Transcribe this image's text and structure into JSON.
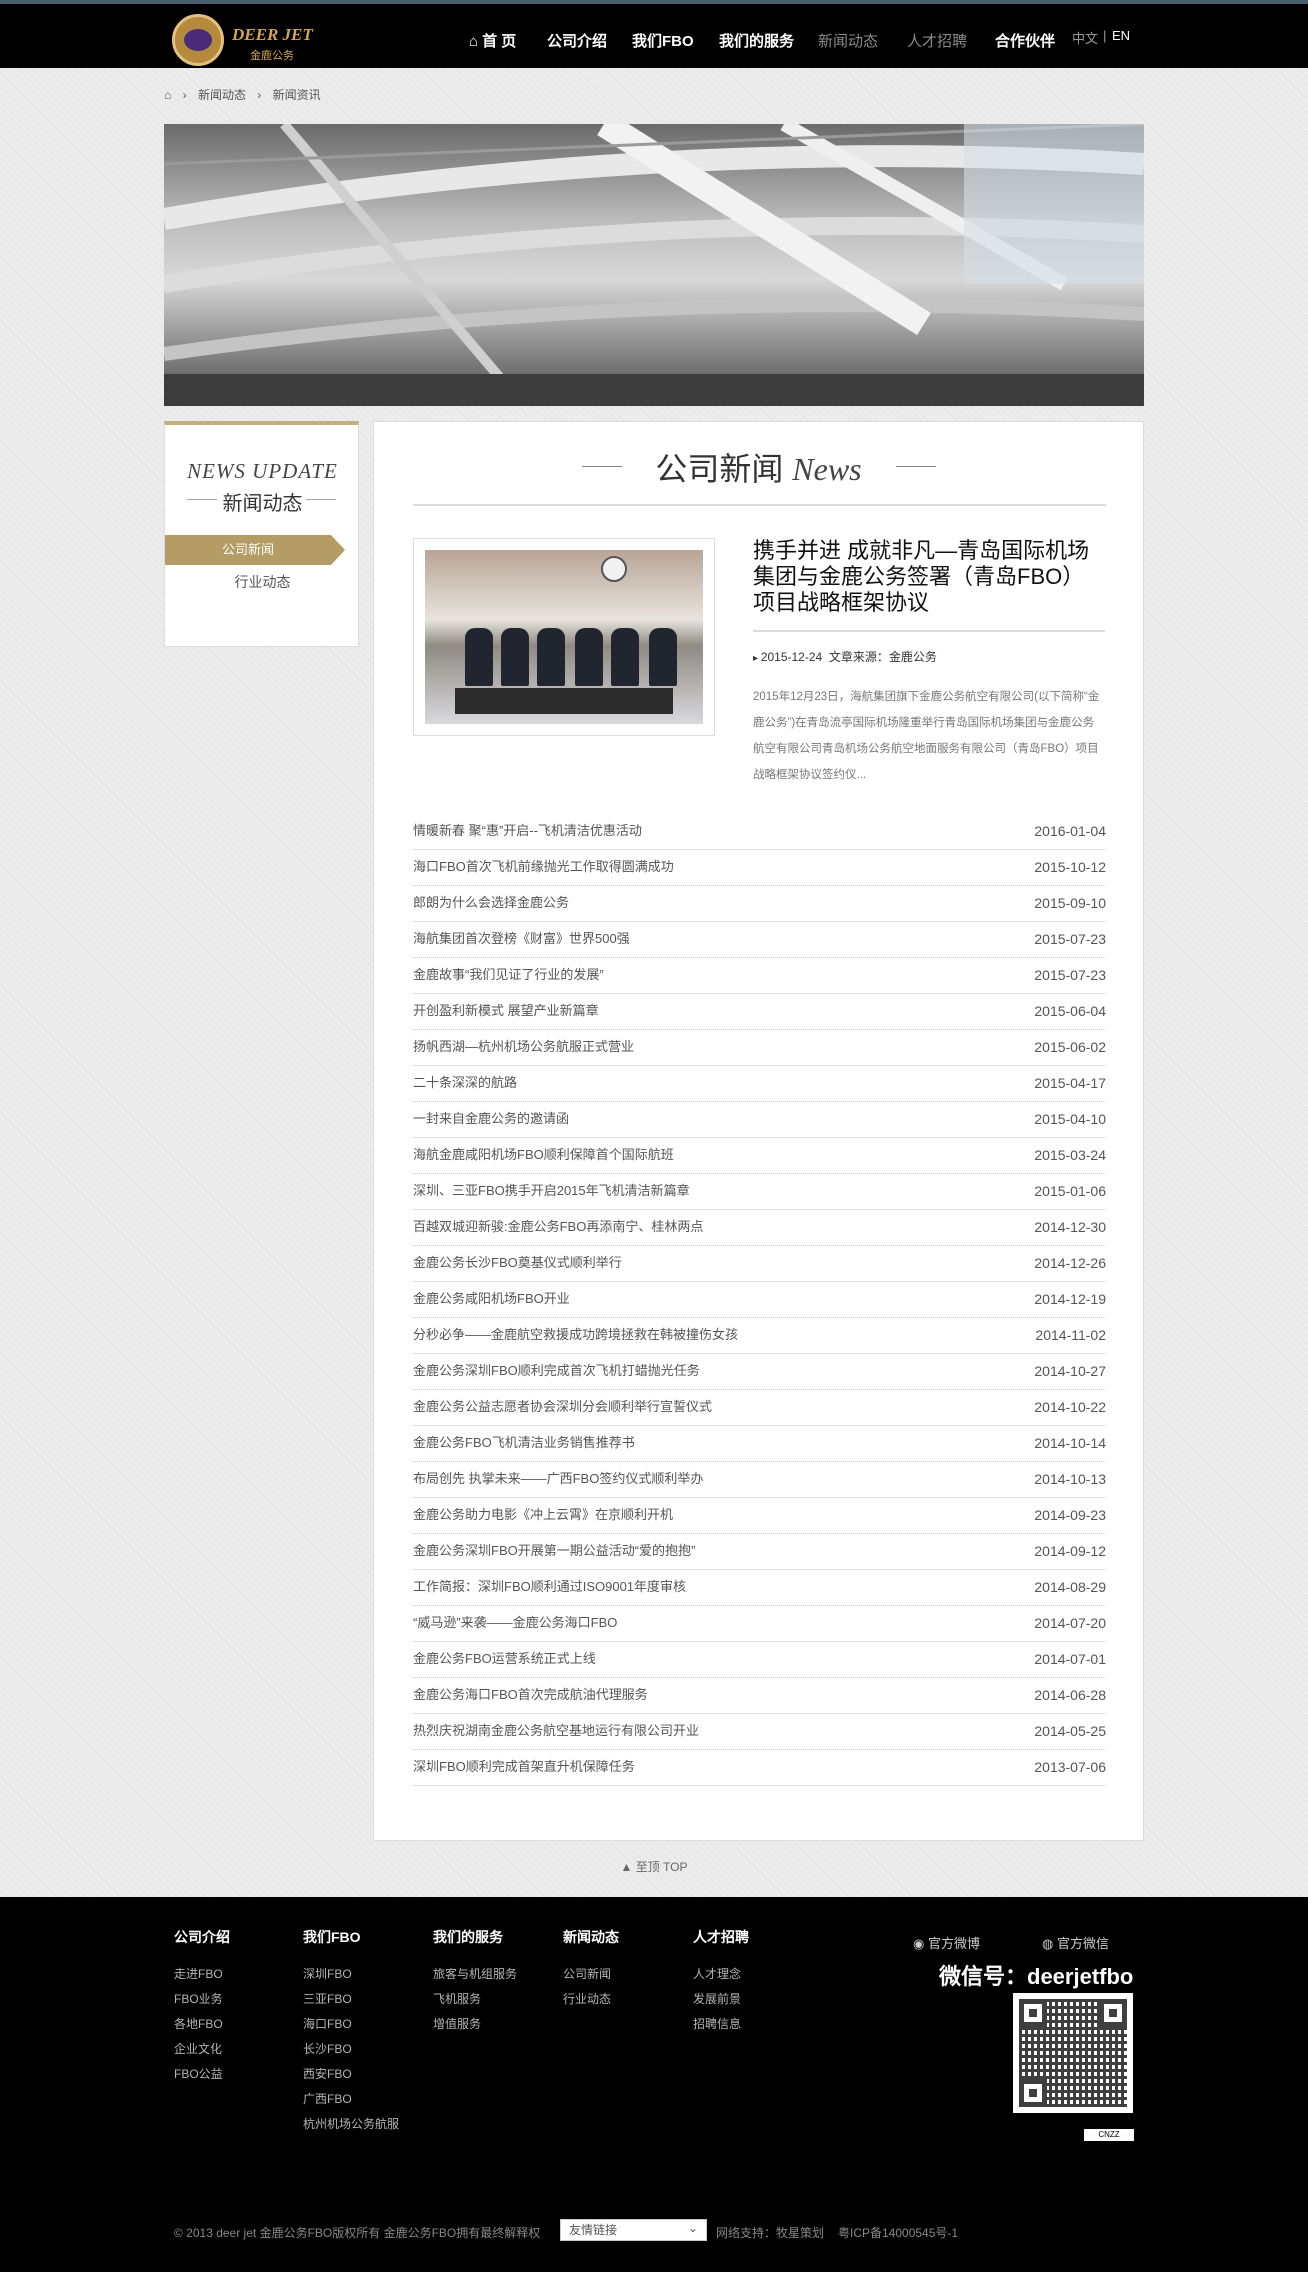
{
  "header": {
    "logo_en": "DEER JET",
    "logo_cn": "金鹿公务",
    "nav": [
      {
        "label": "首 页"
      },
      {
        "label": "公司介绍"
      },
      {
        "label": "我们FBO"
      },
      {
        "label": "我们的服务"
      },
      {
        "label": "新闻动态"
      },
      {
        "label": "人才招聘"
      },
      {
        "label": "合作伙伴"
      }
    ],
    "lang_cn": "中文",
    "lang_sep": "|",
    "lang_en": "EN"
  },
  "breadcrumb": [
    "新闻动态",
    "新闻资讯"
  ],
  "sidebar": {
    "title_en": "NEWS UPDATE",
    "title_cn": "新闻动态",
    "items": [
      {
        "label": "公司新闻"
      },
      {
        "label": "行业动态"
      }
    ]
  },
  "main": {
    "title_cn": "公司新闻",
    "title_en": "News",
    "featured": {
      "headline": "携手并进 成就非凡—青岛国际机场集团与金鹿公务签署（青岛FBO）项目战略框架协议",
      "date": "2015-12-24",
      "source": "文章来源：金鹿公务",
      "summary": "2015年12月23日，海航集团旗下金鹿公务航空有限公司(以下简称“金鹿公务”)在青岛流亭国际机场隆重举行青岛国际机场集团与金鹿公务航空有限公司青岛机场公务航空地面服务有限公司（青岛FBO）项目战略框架协议签约仪..."
    },
    "news": [
      {
        "title": "情暖新春 聚“惠”开启--飞机清洁优惠活动",
        "date": "2016-01-04"
      },
      {
        "title": "海口FBO首次飞机前缘抛光工作取得圆满成功",
        "date": "2015-10-12"
      },
      {
        "title": "郎朗为什么会选择金鹿公务",
        "date": "2015-09-10"
      },
      {
        "title": "海航集团首次登榜《财富》世界500强",
        "date": "2015-07-23"
      },
      {
        "title": "金鹿故事“我们见证了行业的发展”",
        "date": "2015-07-23"
      },
      {
        "title": "开创盈利新模式 展望产业新篇章",
        "date": "2015-06-04"
      },
      {
        "title": "扬帆西湖—杭州机场公务航服正式营业",
        "date": "2015-06-02"
      },
      {
        "title": "二十条深深的航路",
        "date": "2015-04-17"
      },
      {
        "title": "一封来自金鹿公务的邀请函",
        "date": "2015-04-10"
      },
      {
        "title": "海航金鹿咸阳机场FBO顺利保障首个国际航班",
        "date": "2015-03-24"
      },
      {
        "title": "深圳、三亚FBO携手开启2015年飞机清洁新篇章",
        "date": "2015-01-06"
      },
      {
        "title": "百越双城迎新骏:金鹿公务FBO再添南宁、桂林两点",
        "date": "2014-12-30"
      },
      {
        "title": "金鹿公务长沙FBO奠基仪式顺利举行",
        "date": "2014-12-26"
      },
      {
        "title": "金鹿公务咸阳机场FBO开业",
        "date": "2014-12-19"
      },
      {
        "title": "分秒必争——金鹿航空救援成功跨境拯救在韩被撞伤女孩",
        "date": "2014-11-02"
      },
      {
        "title": "金鹿公务深圳FBO顺利完成首次飞机打蜡抛光任务",
        "date": "2014-10-27"
      },
      {
        "title": "金鹿公务公益志愿者协会深圳分会顺利举行宣誓仪式",
        "date": "2014-10-22"
      },
      {
        "title": "金鹿公务FBO飞机清洁业务销售推荐书",
        "date": "2014-10-14"
      },
      {
        "title": "布局创先 执掌未来——广西FBO签约仪式顺利举办",
        "date": "2014-10-13"
      },
      {
        "title": "金鹿公务助力电影《冲上云霄》在京顺利开机",
        "date": "2014-09-23"
      },
      {
        "title": "金鹿公务深圳FBO开展第一期公益活动“爱的抱抱”",
        "date": "2014-09-12"
      },
      {
        "title": "工作简报：深圳FBO顺利通过ISO9001年度审核",
        "date": "2014-08-29"
      },
      {
        "title": "“威马逊”来袭——金鹿公务海口FBO",
        "date": "2014-07-20"
      },
      {
        "title": "金鹿公务FBO运营系统正式上线",
        "date": "2014-07-01"
      },
      {
        "title": "金鹿公务海口FBO首次完成航油代理服务",
        "date": "2014-06-28"
      },
      {
        "title": "热烈庆祝湖南金鹿公务航空基地运行有限公司开业",
        "date": "2014-05-25"
      },
      {
        "title": "深圳FBO顺利完成首架直升机保障任务",
        "date": "2013-07-06"
      }
    ]
  },
  "totop": "▲ 至顶 TOP",
  "footer": {
    "columns": [
      {
        "title": "公司介绍",
        "links": [
          "走进FBO",
          "FBO业务",
          "各地FBO",
          "企业文化",
          "FBO公益"
        ]
      },
      {
        "title": "我们FBO",
        "links": [
          "深圳FBO",
          "三亚FBO",
          "海口FBO",
          "长沙FBO",
          "西安FBO",
          "广西FBO",
          "杭州机场公务航服"
        ]
      },
      {
        "title": "我们的服务",
        "links": [
          "旅客与机组服务",
          "飞机服务",
          "增值服务"
        ]
      },
      {
        "title": "新闻动态",
        "links": [
          "公司新闻",
          "行业动态"
        ]
      },
      {
        "title": "人才招聘",
        "links": [
          "人才理念",
          "发展前景",
          "招聘信息"
        ]
      }
    ],
    "weibo": "官方微博",
    "weixin": "官方微信",
    "wechat_id": "微信号：deerjetfbo",
    "cnzz": "CNZZ",
    "copyright": "© 2013 deer jet 金鹿公务FBO版权所有 金鹿公务FBO拥有最终解释权",
    "friend_links": "友情链接",
    "support": "网络支持：牧星策划",
    "icp": "粤ICP备14000545号-1"
  }
}
